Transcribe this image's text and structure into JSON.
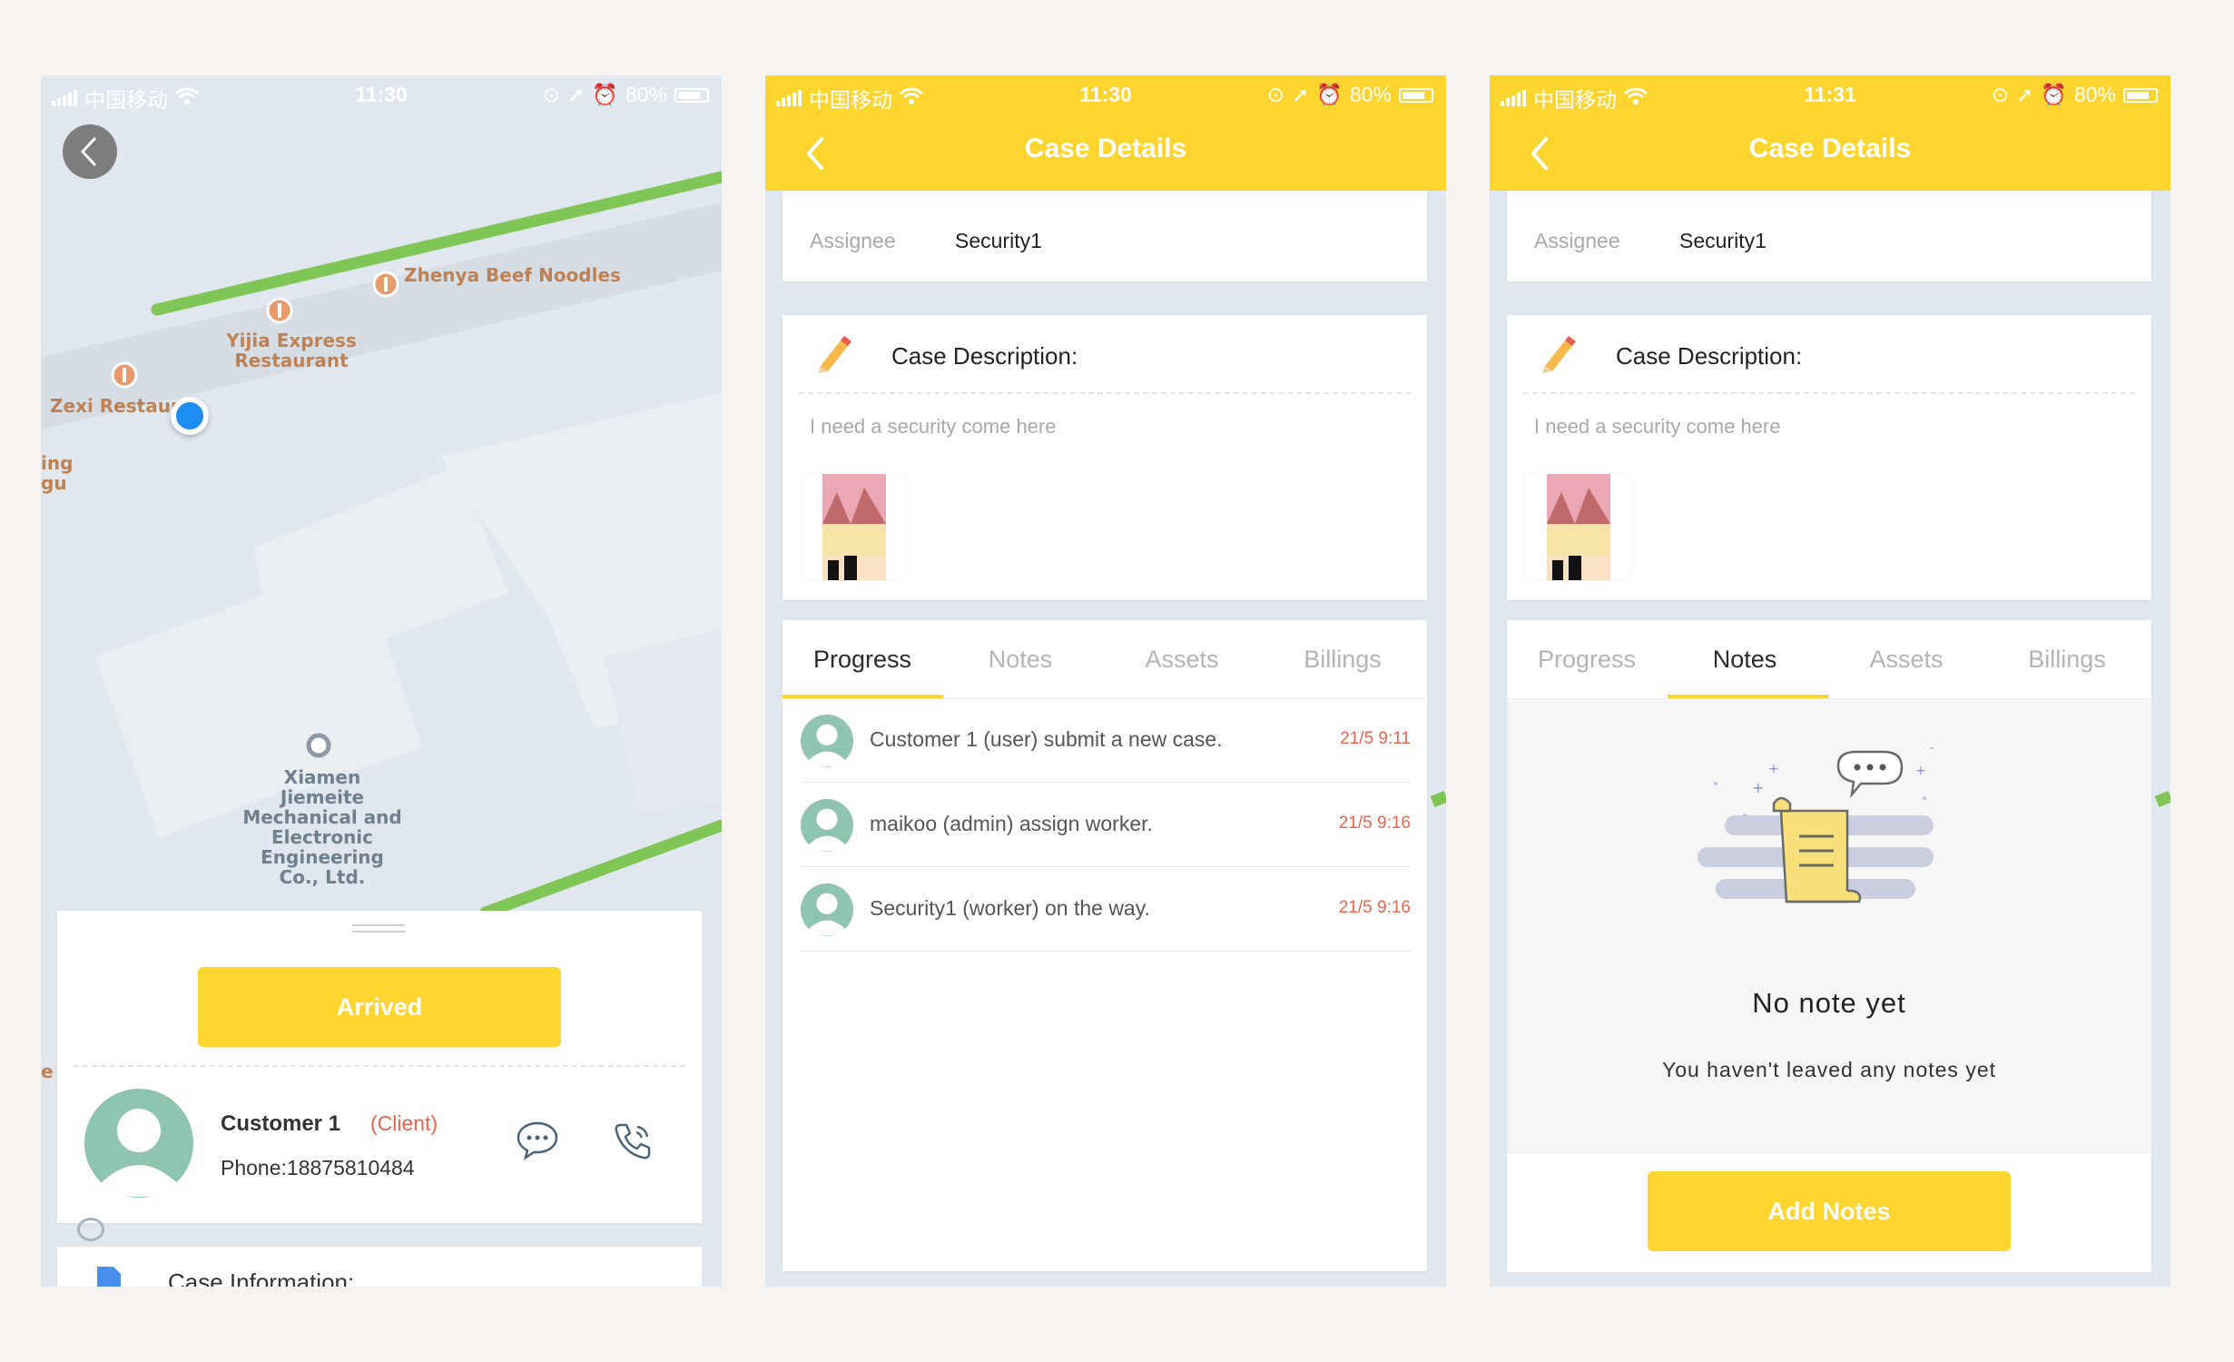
{
  "screens": [
    {
      "status": {
        "carrier": "中国移动",
        "time": "11:30",
        "battery": "80%"
      },
      "map": {
        "pois": [
          "Zhenya Beef Noodles",
          "Yijia Express Restaurant",
          "Zexi Restaur",
          "Xiamen Jiemeite Mechanical and Electronic Engineering Co., Ltd."
        ],
        "edge_text": [
          "ing",
          "gu",
          "e"
        ]
      },
      "sheet": {
        "arrived_label": "Arrived",
        "customer_name": "Customer 1",
        "customer_role": "(Client)",
        "phone": "Phone:18875810484",
        "next_section": "Case Information:"
      },
      "icons": {
        "back": "chevron-left-icon",
        "message": "chat-bubble-icon",
        "call": "phone-icon",
        "doc": "document-icon"
      }
    },
    {
      "status": {
        "carrier": "中国移动",
        "time": "11:30",
        "battery": "80%"
      },
      "header_title": "Case Details",
      "assignee_label": "Assignee",
      "assignee_value": "Security1",
      "description_title": "Case Description:",
      "description_text": "I need a security come here",
      "tabs": [
        "Progress",
        "Notes",
        "Assets",
        "Billings"
      ],
      "active_tab": "Progress",
      "progress": [
        {
          "text": "Customer 1 (user) submit a new case.",
          "time": "21/5 9:11"
        },
        {
          "text": "maikoo (admin) assign worker.",
          "time": "21/5 9:16"
        },
        {
          "text": "Security1 (worker) on the way.",
          "time": "21/5 9:16"
        }
      ]
    },
    {
      "status": {
        "carrier": "中国移动",
        "time": "11:31",
        "battery": "80%"
      },
      "header_title": "Case Details",
      "assignee_label": "Assignee",
      "assignee_value": "Security1",
      "description_title": "Case Description:",
      "description_text": "I need a security come here",
      "tabs": [
        "Progress",
        "Notes",
        "Assets",
        "Billings"
      ],
      "active_tab": "Notes",
      "empty_title": "No note yet",
      "empty_sub": "You haven't leaved any notes yet",
      "add_label": "Add Notes"
    }
  ],
  "colors": {
    "accent": "#fed52f",
    "time_red": "#e5654f",
    "route_green": "#7fc657",
    "avatar_teal": "#8ec4b0"
  }
}
